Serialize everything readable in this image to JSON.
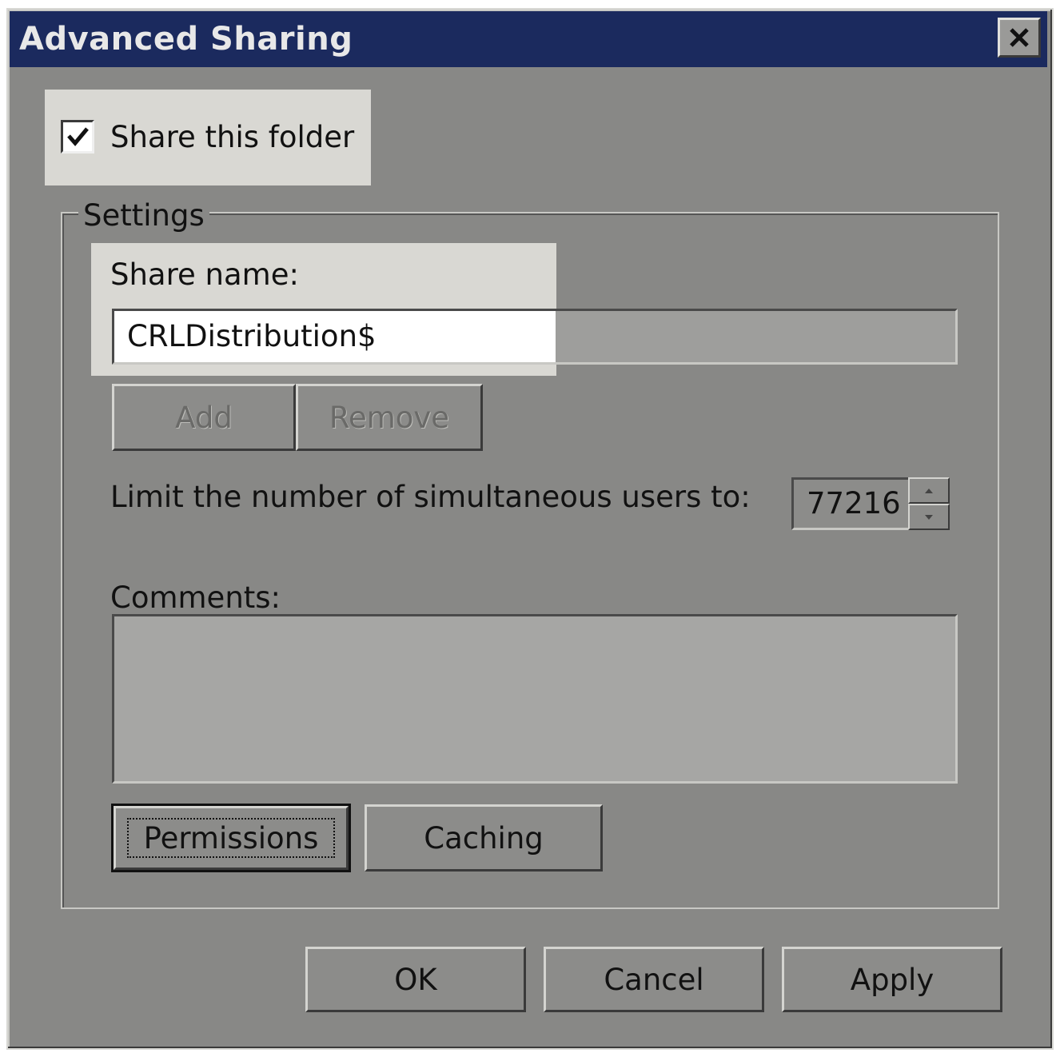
{
  "window": {
    "title": "Advanced Sharing",
    "close_glyph": "✕"
  },
  "share_checkbox": {
    "label": "Share this folder",
    "checked": true
  },
  "settings": {
    "group_label": "Settings",
    "share_name_label": "Share name:",
    "share_name_value": "CRLDistribution$",
    "add_label": "Add",
    "remove_label": "Remove",
    "limit_label": "Limit the number of simultaneous users to:",
    "limit_value": "77216",
    "comments_label": "Comments:",
    "comments_value": "",
    "permissions_label": "Permissions",
    "caching_label": "Caching"
  },
  "footer": {
    "ok_label": "OK",
    "cancel_label": "Cancel",
    "apply_label": "Apply"
  },
  "colors": {
    "titlebar": "#1b2a5e",
    "dialog_bg": "#888886",
    "highlight": "#d9d8d3"
  }
}
